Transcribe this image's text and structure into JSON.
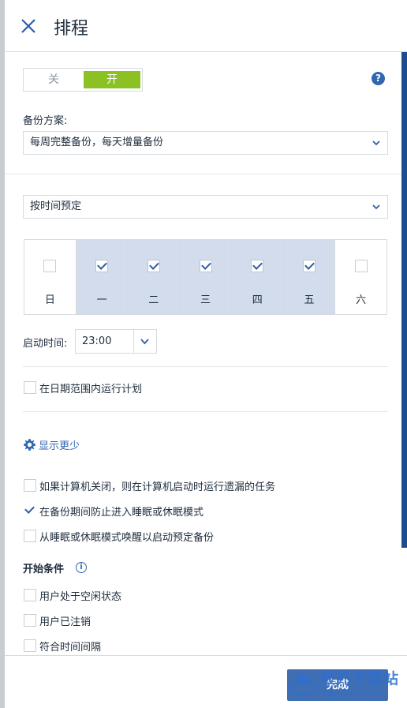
{
  "header": {
    "title": "排程"
  },
  "toggle": {
    "off_label": "关",
    "on_label": "开",
    "state": "on"
  },
  "backup_scheme": {
    "label": "备份方案:",
    "value": "每周完整备份，每天增量备份"
  },
  "schedule_type": {
    "value": "按时间预定"
  },
  "days": [
    {
      "label": "日",
      "checked": false
    },
    {
      "label": "一",
      "checked": true
    },
    {
      "label": "二",
      "checked": true
    },
    {
      "label": "三",
      "checked": true
    },
    {
      "label": "四",
      "checked": true
    },
    {
      "label": "五",
      "checked": true
    },
    {
      "label": "六",
      "checked": false
    }
  ],
  "start_time": {
    "label": "启动时间:",
    "value": "23:00"
  },
  "date_range": {
    "label": "在日期范围内运行计划",
    "checked": false
  },
  "show_less": {
    "label": "显示更少"
  },
  "options": [
    {
      "label": "如果计算机关闭，则在计算机启动时运行遗漏的任务",
      "checked": false
    },
    {
      "label": "在备份期间防止进入睡眠或休眠模式",
      "checked": true
    },
    {
      "label": "从睡眠或休眠模式唤醒以启动预定备份",
      "checked": false
    }
  ],
  "start_conditions": {
    "title": "开始条件",
    "items": [
      {
        "label": "用户处于空闲状态",
        "checked": false
      },
      {
        "label": "用户已注销",
        "checked": false
      },
      {
        "label": "符合时间间隔",
        "checked": false
      }
    ]
  },
  "footer": {
    "done_label": "完成"
  },
  "watermark": {
    "text": "极光下载站",
    "url": "www.xz7.com"
  },
  "colors": {
    "accent": "#3167b1",
    "toggle_on": "#8cc124",
    "selected_day": "#d2dcec",
    "scrollbar": "#1d4d8f"
  }
}
